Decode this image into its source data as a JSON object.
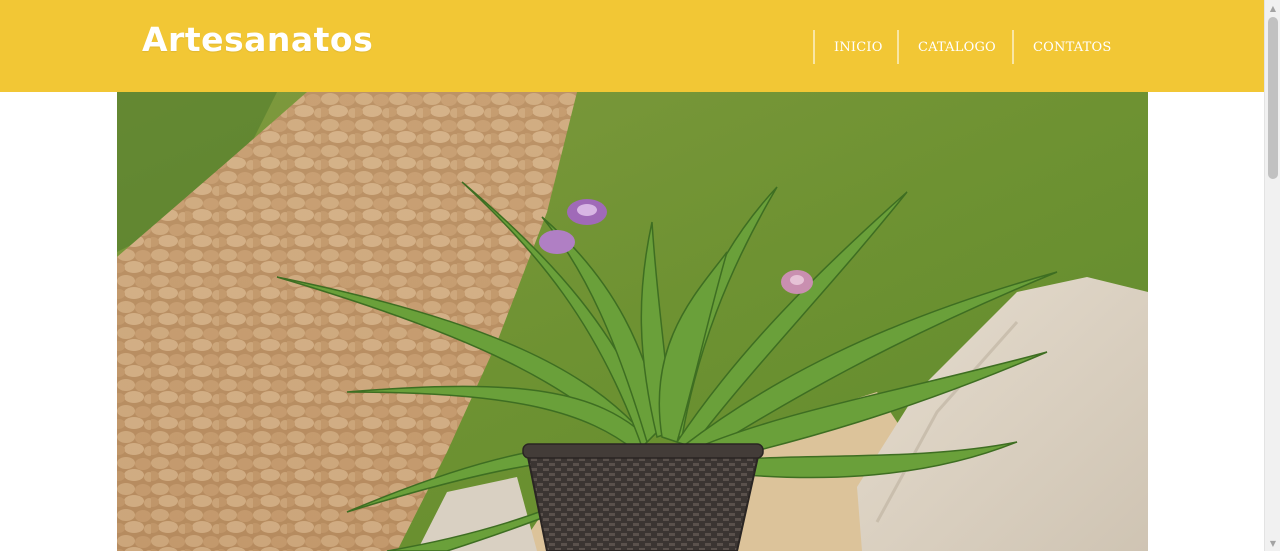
{
  "header": {
    "logo_text": "Artesanatos",
    "background_color": "#f2c735"
  },
  "nav": {
    "items": [
      {
        "label": "INICIO"
      },
      {
        "label": "CATALOGO"
      },
      {
        "label": "CONTATOS"
      }
    ]
  },
  "hero": {
    "image_subject": "potted bromeliad plant with purple flowers in a dark woven basket, stone wall and grass background"
  },
  "scrollbar": {
    "up_icon": "triangle-up",
    "down_icon": "triangle-down"
  }
}
